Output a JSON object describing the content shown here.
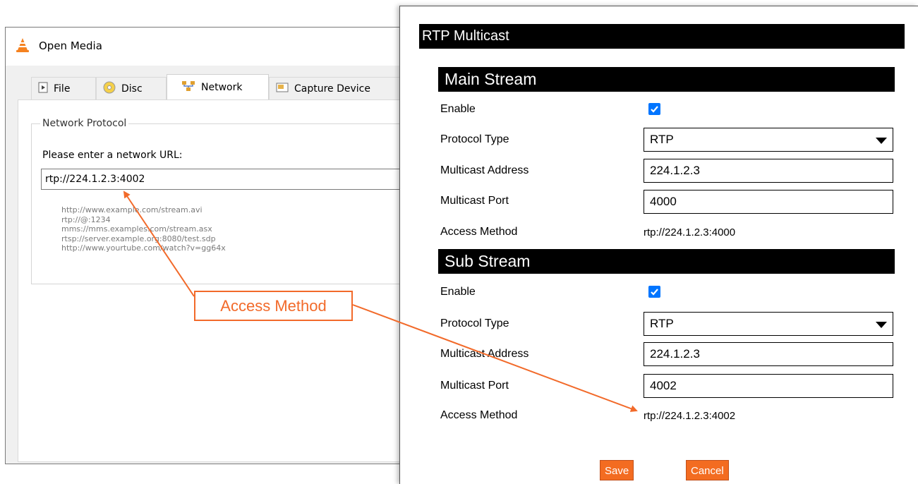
{
  "vlc": {
    "window_title": "Open Media",
    "tabs": [
      {
        "label": "File",
        "icon": "file-icon"
      },
      {
        "label": "Disc",
        "icon": "disc-icon"
      },
      {
        "label": "Network",
        "icon": "network-icon",
        "active": true
      },
      {
        "label": "Capture Device",
        "icon": "capture-device-icon"
      }
    ],
    "group_label": "Network Protocol",
    "url_prompt": "Please enter a network URL:",
    "url_value": "rtp://224.1.2.3:4002",
    "examples": [
      "http://www.example.com/stream.avi",
      "rtp://@:1234",
      "mms://mms.examples.com/stream.asx",
      "rtsp://server.example.org:8080/test.sdp",
      "http://www.yourtube.com/watch?v=gg64x"
    ]
  },
  "rtp": {
    "title": "RTP Multicast",
    "main_stream": {
      "header": "Main Stream",
      "enable_label": "Enable",
      "enabled": true,
      "protocol_label": "Protocol Type",
      "protocol_value": "RTP",
      "address_label": "Multicast Address",
      "address_value": "224.1.2.3",
      "port_label": "Multicast Port",
      "port_value": "4000",
      "access_label": "Access Method",
      "access_value": "rtp://224.1.2.3:4000"
    },
    "sub_stream": {
      "header": "Sub Stream",
      "enable_label": "Enable",
      "enabled": true,
      "protocol_label": "Protocol Type",
      "protocol_value": "RTP",
      "address_label": "Multicast Address",
      "address_value": "224.1.2.3",
      "port_label": "Multicast Port",
      "port_value": "4002",
      "access_label": "Access Method",
      "access_value": "rtp://224.1.2.3:4002"
    },
    "save_label": "Save",
    "cancel_label": "Cancel"
  },
  "annotation": {
    "label": "Access Method",
    "color": "#f26a2a"
  },
  "colors": {
    "button_orange": "#f36c21",
    "checkbox_blue": "#0075ff",
    "header_black": "#000000"
  }
}
